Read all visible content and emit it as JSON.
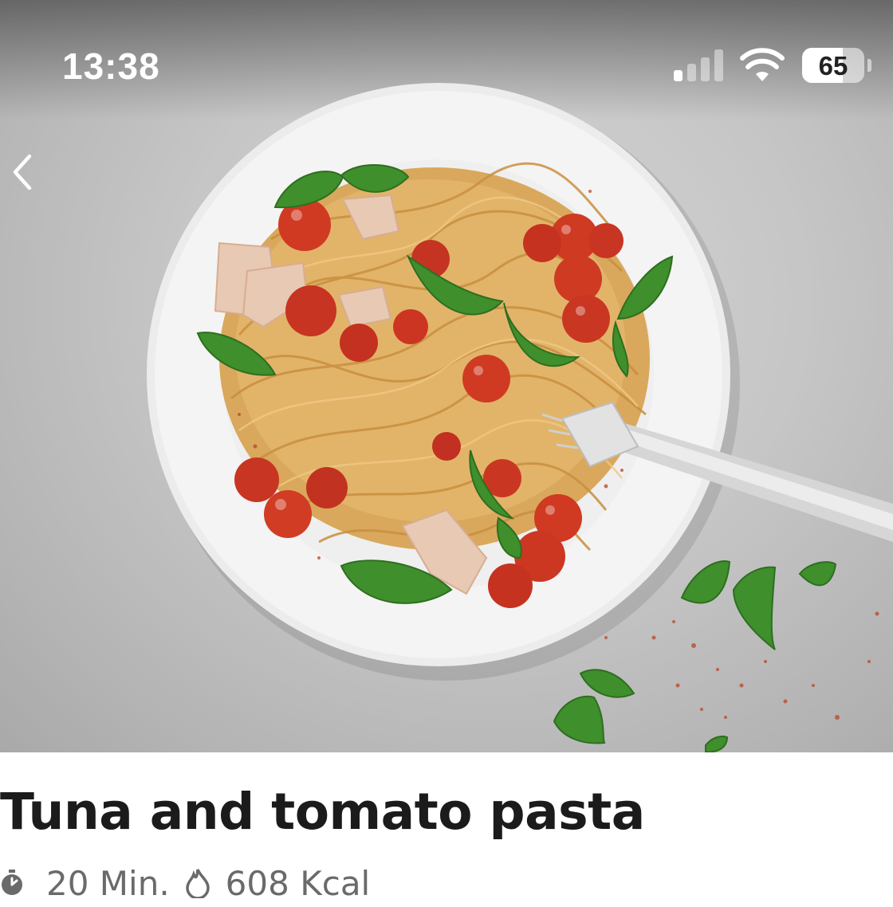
{
  "status_bar": {
    "time": "13:38",
    "battery_percent": "65",
    "battery_level": 0.65,
    "signal_bars_active": 1,
    "signal_bars_total": 4,
    "icons": [
      "cellular-signal-icon",
      "wifi-icon",
      "battery-icon"
    ]
  },
  "navigation": {
    "back_icon": "chevron-left-icon"
  },
  "hero": {
    "image": "tuna-tomato-pasta-photo"
  },
  "recipe": {
    "title": "Tuna and tomato pasta",
    "duration": "20 Min.",
    "duration_icon": "timer-icon",
    "calories": "608 Kcal",
    "calories_icon": "flame-icon"
  },
  "colors": {
    "title": "#1b1b1b",
    "meta": "#6a6a6a",
    "status_text": "#ffffff"
  }
}
